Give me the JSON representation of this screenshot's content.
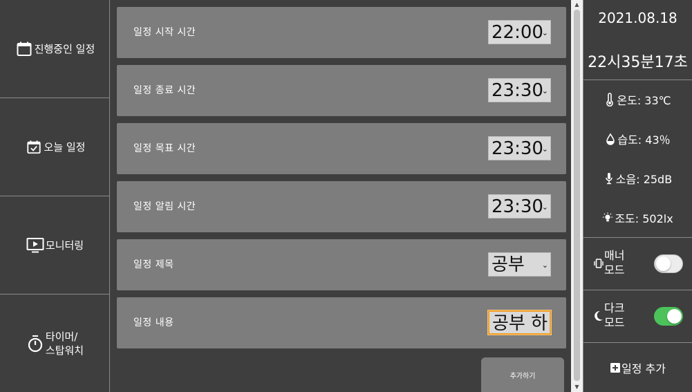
{
  "sidebar": {
    "items": [
      {
        "icon": "calendar-icon",
        "label": "진행중인 일정"
      },
      {
        "icon": "calendar-check-icon",
        "label": "오늘 일정"
      },
      {
        "icon": "monitor-play-icon",
        "label": "모니터링"
      },
      {
        "icon": "stopwatch-icon",
        "label_line1": "타이머/",
        "label_line2": "스탑워치"
      }
    ]
  },
  "form": {
    "rows": [
      {
        "label": "일정 시작 시간",
        "value": "22:00"
      },
      {
        "label": "일정 종료 시간",
        "value": "23:30"
      },
      {
        "label": "일정 목표 시간",
        "value": "23:30"
      },
      {
        "label": "일정 알림 시간",
        "value": "23:30"
      },
      {
        "label": "일정 제목",
        "value": "공부"
      },
      {
        "label": "일정 내용",
        "value": "공부 하"
      }
    ],
    "add_button": "추가하기"
  },
  "status": {
    "date": "2021.08.18",
    "time": "22시35분17초",
    "temperature": "온도: 33℃",
    "humidity": "습도: 43％",
    "noise": "소음: 25dB",
    "illuminance": "조도: 502lx"
  },
  "modes": {
    "manner": {
      "line1": "매너",
      "line2": "모드",
      "on": false
    },
    "dark": {
      "line1": "다크",
      "line2": "모드",
      "on": true
    }
  },
  "right_action": "일정 추가",
  "colors": {
    "panel_bg": "#3e3e3e",
    "row_bg": "#7d7d7d",
    "toggle_on": "#4cc35a",
    "focus_ring": "#f0a02c"
  }
}
